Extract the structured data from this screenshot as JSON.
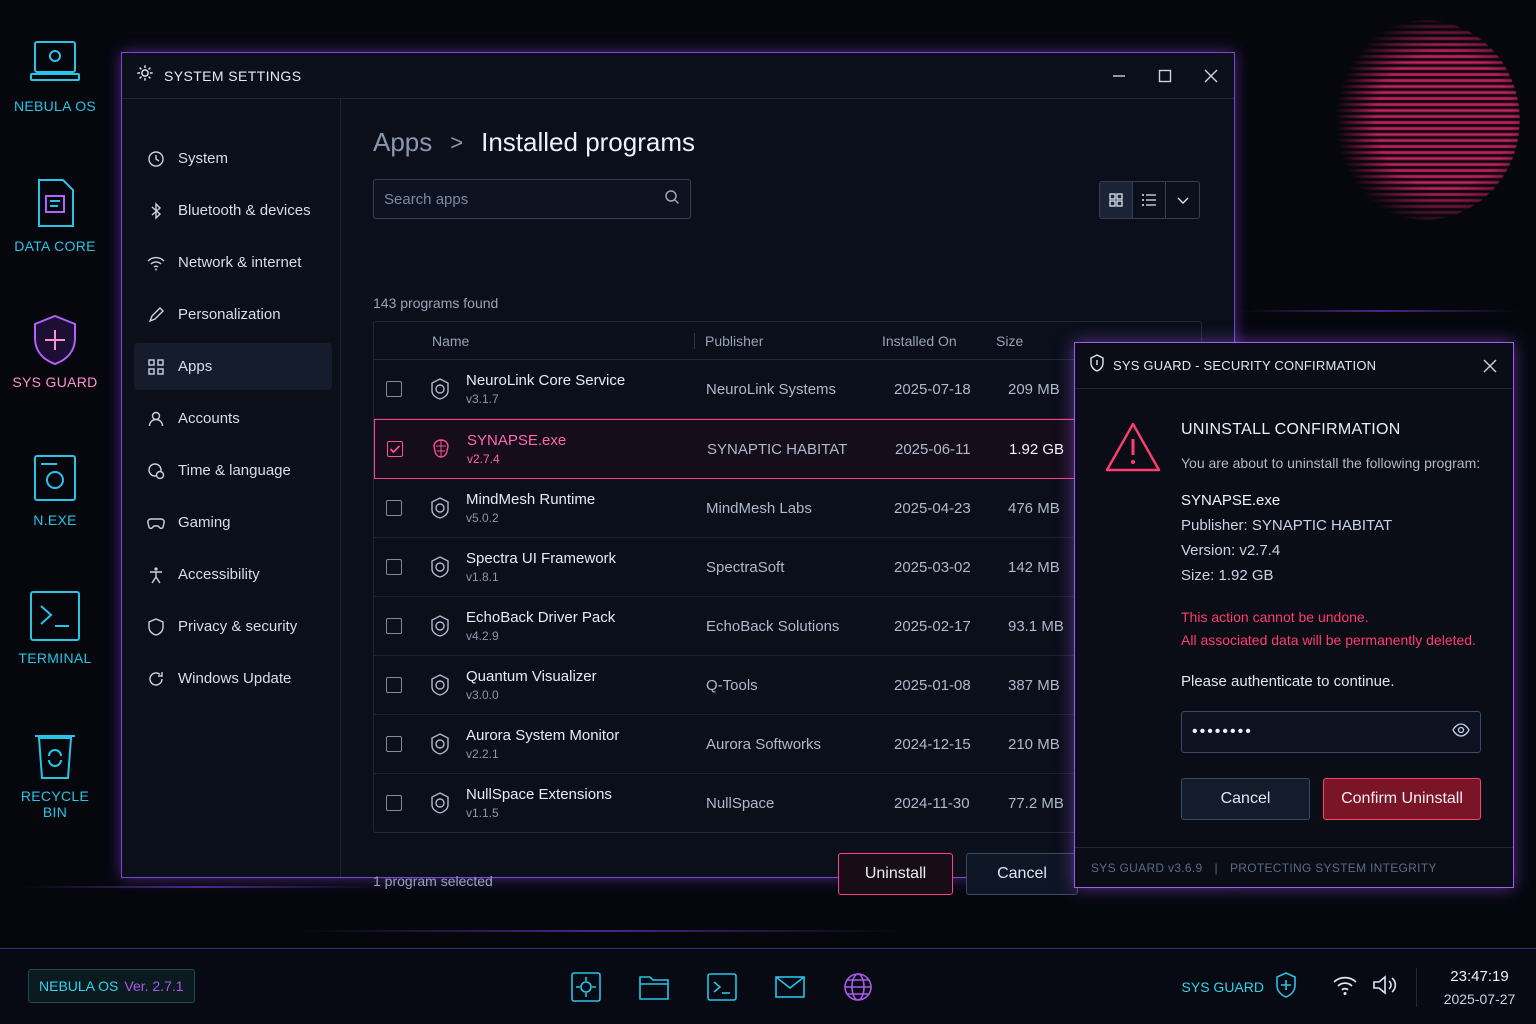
{
  "desktop": {
    "icons": [
      {
        "label": "NEBULA OS"
      },
      {
        "label": "DATA CORE"
      },
      {
        "label": "SYS GUARD"
      },
      {
        "label": "N.EXE"
      },
      {
        "label": "TERMINAL"
      },
      {
        "label": "RECYCLE BIN"
      }
    ]
  },
  "window": {
    "title": "SYSTEM SETTINGS"
  },
  "sidebar": {
    "items": [
      {
        "label": "System",
        "icon": "system-icon"
      },
      {
        "label": "Bluetooth & devices",
        "icon": "bluetooth-icon"
      },
      {
        "label": "Network & internet",
        "icon": "wifi-icon"
      },
      {
        "label": "Personalization",
        "icon": "pen-icon"
      },
      {
        "label": "Apps",
        "icon": "apps-icon",
        "active": true
      },
      {
        "label": "Accounts",
        "icon": "user-icon"
      },
      {
        "label": "Time & language",
        "icon": "globe-clock-icon"
      },
      {
        "label": "Gaming",
        "icon": "gamepad-icon"
      },
      {
        "label": "Accessibility",
        "icon": "accessibility-icon"
      },
      {
        "label": "Privacy & security",
        "icon": "shield-icon"
      },
      {
        "label": "Windows Update",
        "icon": "update-icon"
      }
    ]
  },
  "main": {
    "breadcrumb": {
      "parent": "Apps",
      "separator": ">",
      "current": "Installed programs"
    },
    "search": {
      "placeholder": "Search apps",
      "value": ""
    },
    "count_text": "143 programs found",
    "columns": {
      "name": "Name",
      "publisher": "Publisher",
      "installed": "Installed On",
      "size": "Size"
    },
    "rows": [
      {
        "name": "NeuroLink Core Service",
        "version": "v3.1.7",
        "publisher": "NeuroLink Systems",
        "date": "2025-07-18",
        "size": "209 MB",
        "selected": false
      },
      {
        "name": "SYNAPSE.exe",
        "version": "v2.7.4",
        "publisher": "SYNAPTIC HABITAT",
        "date": "2025-06-11",
        "size": "1.92 GB",
        "selected": true
      },
      {
        "name": "MindMesh Runtime",
        "version": "v5.0.2",
        "publisher": "MindMesh Labs",
        "date": "2025-04-23",
        "size": "476 MB",
        "selected": false
      },
      {
        "name": "Spectra UI Framework",
        "version": "v1.8.1",
        "publisher": "SpectraSoft",
        "date": "2025-03-02",
        "size": "142 MB",
        "selected": false
      },
      {
        "name": "EchoBack Driver Pack",
        "version": "v4.2.9",
        "publisher": "EchoBack Solutions",
        "date": "2025-02-17",
        "size": "93.1 MB",
        "selected": false
      },
      {
        "name": "Quantum Visualizer",
        "version": "v3.0.0",
        "publisher": "Q-Tools",
        "date": "2025-01-08",
        "size": "387 MB",
        "selected": false
      },
      {
        "name": "Aurora System Monitor",
        "version": "v2.2.1",
        "publisher": "Aurora Softworks",
        "date": "2024-12-15",
        "size": "210 MB",
        "selected": false
      },
      {
        "name": "NullSpace Extensions",
        "version": "v1.1.5",
        "publisher": "NullSpace",
        "date": "2024-11-30",
        "size": "77.2 MB",
        "selected": false
      }
    ],
    "selected_text": "1 program selected",
    "uninstall_label": "Uninstall",
    "cancel_label": "Cancel"
  },
  "dialog": {
    "title": "SYS GUARD - SECURITY CONFIRMATION",
    "heading": "UNINSTALL CONFIRMATION",
    "subtitle": "You are about to uninstall the following program:",
    "program": "SYNAPSE.exe",
    "publisher_line": "Publisher: SYNAPTIC HABITAT",
    "version_line": "Version: v2.7.4",
    "size_line": "Size: 1.92 GB",
    "warning_1": "This action cannot be undone.",
    "warning_2": "All associated data will be permanently deleted.",
    "auth_prompt": "Please authenticate to continue.",
    "password_value": "••••••••",
    "cancel_label": "Cancel",
    "confirm_label": "Confirm Uninstall",
    "footer_version": "SYS GUARD v3.6.9",
    "footer_sep": "|",
    "footer_tag": "PROTECTING SYSTEM INTEGRITY"
  },
  "taskbar": {
    "os_name": "NEBULA OS",
    "os_version": "Ver. 2.7.1",
    "sysguard_label": "SYS GUARD",
    "time": "23:47:19",
    "date": "2025-07-27"
  },
  "colors": {
    "accent_cyan": "#2fd3f0",
    "accent_pink": "#ff3d8a",
    "accent_purple": "#9b5cf0",
    "danger": "#ff3d6e"
  }
}
